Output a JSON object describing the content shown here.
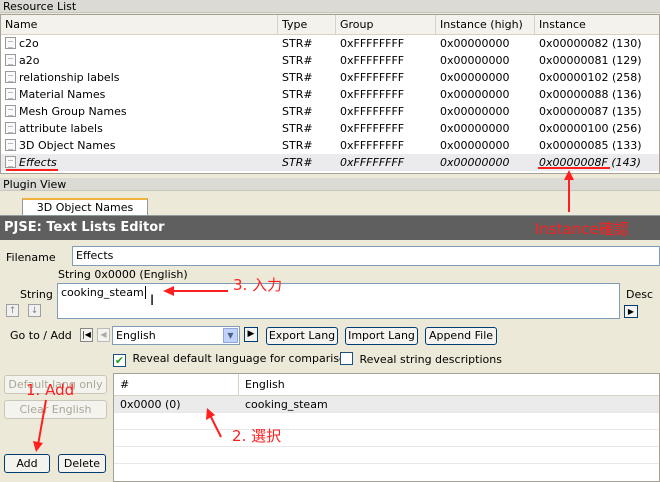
{
  "resource_list": {
    "title": "Resource List",
    "columns": [
      "Name",
      "Type",
      "Group",
      "Instance (high)",
      "Instance"
    ],
    "rows": [
      {
        "name": "c2o",
        "type": "STR#",
        "group": "0xFFFFFFFF",
        "inst_high": "0x00000000",
        "instance": "0x00000082 (130)"
      },
      {
        "name": "a2o",
        "type": "STR#",
        "group": "0xFFFFFFFF",
        "inst_high": "0x00000000",
        "instance": "0x00000081 (129)"
      },
      {
        "name": "relationship labels",
        "type": "STR#",
        "group": "0xFFFFFFFF",
        "inst_high": "0x00000000",
        "instance": "0x00000102 (258)"
      },
      {
        "name": "Material Names",
        "type": "STR#",
        "group": "0xFFFFFFFF",
        "inst_high": "0x00000000",
        "instance": "0x00000088 (136)"
      },
      {
        "name": "Mesh Group Names",
        "type": "STR#",
        "group": "0xFFFFFFFF",
        "inst_high": "0x00000000",
        "instance": "0x00000087 (135)"
      },
      {
        "name": "attribute labels",
        "type": "STR#",
        "group": "0xFFFFFFFF",
        "inst_high": "0x00000000",
        "instance": "0x00000100 (256)"
      },
      {
        "name": "3D Object Names",
        "type": "STR#",
        "group": "0xFFFFFFFF",
        "inst_high": "0x00000000",
        "instance": "0x00000085 (133)"
      },
      {
        "name": "Effects",
        "type": "STR#",
        "group": "0xFFFFFFFF",
        "inst_high": "0x00000000",
        "instance": "0x0000008F (143)"
      }
    ]
  },
  "plugin_view": {
    "title": "Plugin View",
    "tab_label": "3D Object Names",
    "editor_title": "PJSE: Text Lists Editor",
    "filename_label": "Filename",
    "filename_value": "Effects",
    "string_header": "String 0x0000 (English)",
    "string_label": "String",
    "string_value": "cooking_steam",
    "desc_label": "Desc",
    "goto_label": "Go to / Add",
    "language_selected": "English",
    "export_lang": "Export Lang",
    "import_lang": "Import Lang",
    "append_file": "Append File",
    "reveal_default": "Reveal default language for comparison",
    "reveal_desc": "Reveal string descriptions",
    "default_lang_only": "Default lang only",
    "clear_english": "Clear English",
    "add": "Add",
    "delete": "Delete",
    "grid_columns": [
      "#",
      "English"
    ],
    "grid_rows": [
      {
        "index": "0x0000 (0)",
        "text": "cooking_steam"
      }
    ]
  },
  "annotations": {
    "instance_check": "Instance確認",
    "step1": "1. Add",
    "step2": "2. 選択",
    "step3": "3. 入力"
  },
  "colors": {
    "annotation": "#ff1f1f",
    "title_bar": "#5f5f5f"
  }
}
